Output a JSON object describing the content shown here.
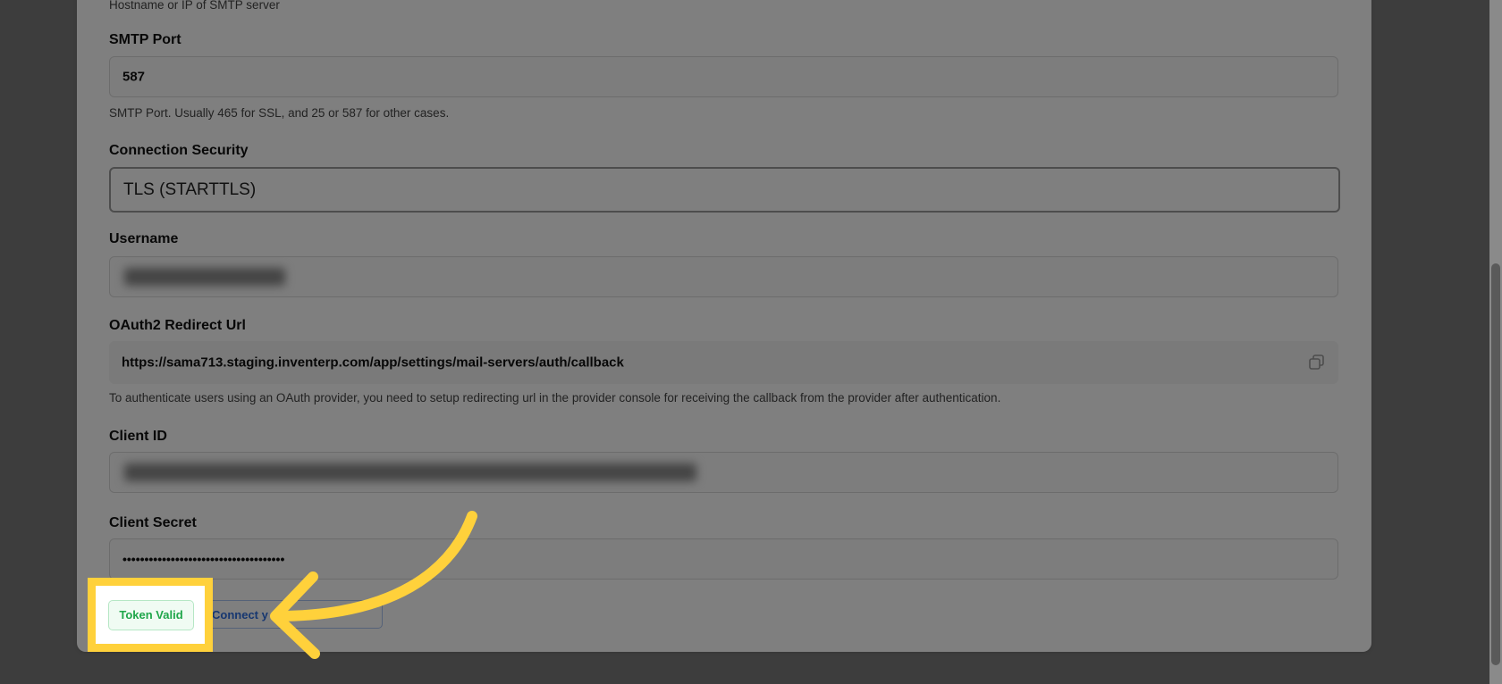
{
  "form": {
    "host_helper": "Hostname or IP of SMTP server",
    "smtp_port": {
      "label": "SMTP Port",
      "value": "587",
      "helper": "SMTP Port. Usually 465 for SSL, and 25 or 587 for other cases."
    },
    "connection_security": {
      "label": "Connection Security",
      "value": "TLS (STARTTLS)"
    },
    "username": {
      "label": "Username"
    },
    "oauth_redirect": {
      "label": "OAuth2 Redirect Url",
      "value": "https://sama713.staging.inventerp.com/app/settings/mail-servers/auth/callback",
      "helper": "To authenticate users using an OAuth provider, you need to setup redirecting url in the provider console for receiving the callback from the provider after authentication.",
      "copy_icon": "copy-icon"
    },
    "client_id": {
      "label": "Client ID"
    },
    "client_secret": {
      "label": "Client Secret",
      "value": "•••••••••••••••••••••••••••••••••••••"
    }
  },
  "actions": {
    "token_valid_label": "Token Valid",
    "connect_label": "Connect y"
  },
  "colors": {
    "highlight": "#ffd13b",
    "token_valid_text": "#1fa64a",
    "connect_text": "#2f6fe0"
  }
}
